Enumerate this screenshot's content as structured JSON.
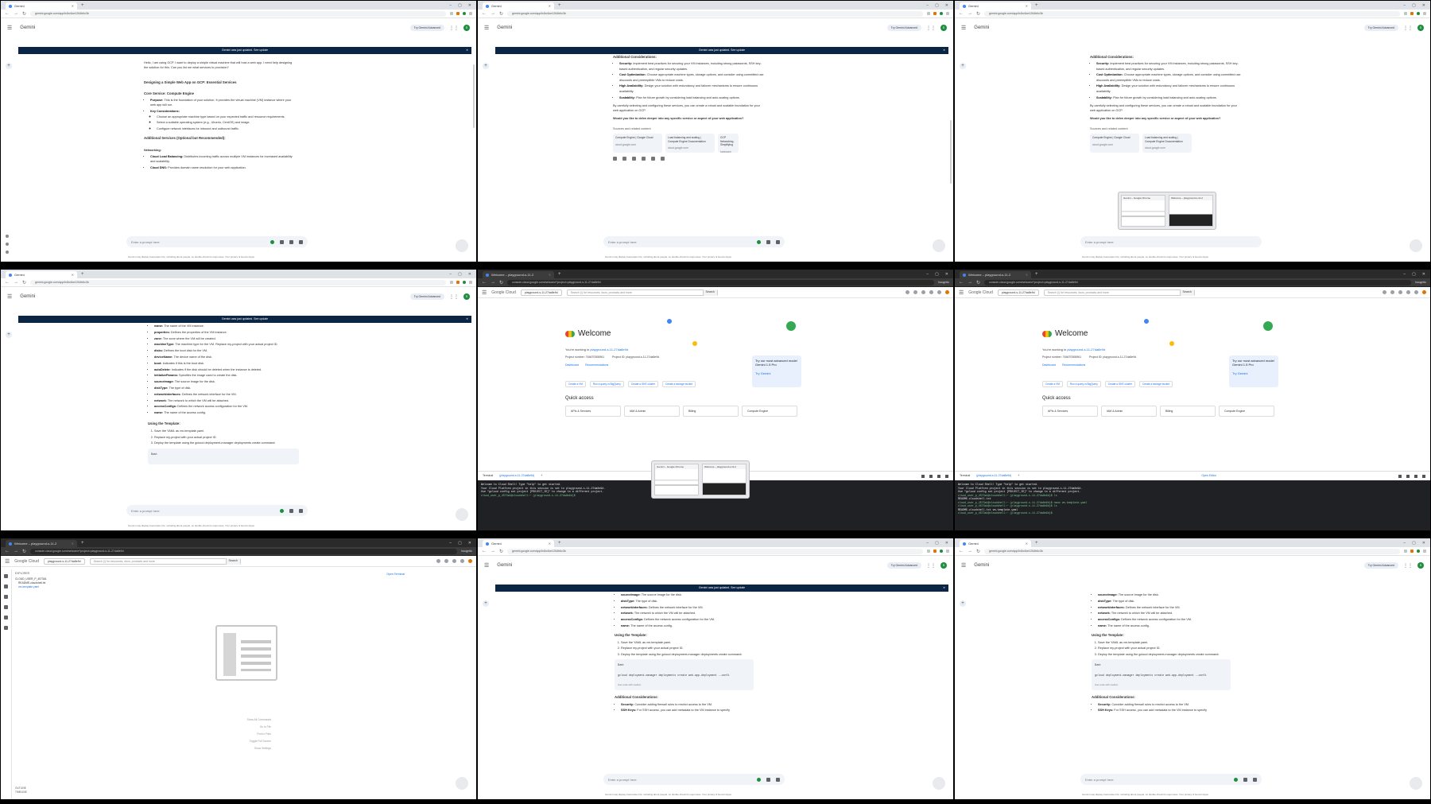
{
  "gemini": {
    "tab_label": "Gemini",
    "url": "gemini.google.com/app/b4bc6ce1264b6c3b",
    "app_title": "Gemini",
    "try_button": "Try Gemini Advanced",
    "avatar_letter": "S",
    "banner_text": "Gemini was just updated. See update",
    "prompt_placeholder": "Enter a prompt here",
    "footer": "Gemini may display inaccurate info, including about people, so double-check its responses. Your privacy & Gemini Apps"
  },
  "tile1": {
    "user_msg": "Hello, I am using GCP. I want to deploy a simple virtual machine that will host a web app. I need help designing the solution for this. Can you list me what services to provision?",
    "response_title": "Designing a Simple Web App on GCP: Essential Services",
    "core_heading": "Core Service: Compute Engine",
    "purpose_label": "Purpose:",
    "purpose_text": "This is the foundation of your solution. It provides the virtual machine (VM) instance where your web app will run.",
    "key_label": "Key Considerations:",
    "kc1": "Choose an appropriate machine type based on your expected traffic and resource requirements.",
    "kc2": "Select a suitable operating system (e.g., Ubuntu, CentOS) and image.",
    "kc3": "Configure network interfaces for inbound and outbound traffic.",
    "additional_heading": "Additional Services (Optional but Recommended):",
    "networking": "Networking:",
    "clb_label": "Cloud Load Balancing:",
    "clb_text": "Distributes incoming traffic across multiple VM instances for increased availability and scalability.",
    "dns_label": "Cloud DNS:",
    "dns_text": "Provides domain name resolution for your web application."
  },
  "tile2": {
    "heading": "Additional Considerations:",
    "sec_label": "Security:",
    "sec_text": "Implement best practices for securing your VM instances, including strong passwords, SSH key-based authentication, and regular security updates.",
    "cost_label": "Cost Optimization:",
    "cost_text": "Choose appropriate machine types, storage options, and consider using committed use discounts and preemptible VMs to reduce costs.",
    "ha_label": "High Availability:",
    "ha_text": "Design your solution with redundancy and failover mechanisms to ensure continuous availability.",
    "scale_label": "Scalability:",
    "scale_text": "Plan for future growth by considering load balancing and auto-scaling options.",
    "closing": "By carefully selecting and configuring these services, you can create a robust and scalable foundation for your web application on GCP.",
    "question": "Would you like to delve deeper into any specific service or aspect of your web application?",
    "sources_label": "Sources and related content",
    "src1_title": "Compute Engine | Google Cloud",
    "src1_url": "cloud.google.com",
    "src2_title": "Load balancing and scaling | Compute Engine Documentation",
    "src2_url": "cloud.google.com",
    "src3_title": "GCP Networking Simplifying",
    "src3_url": "hydrogen"
  },
  "tile4": {
    "items": [
      {
        "k": "name:",
        "v": "The name of the VM instance."
      },
      {
        "k": "properties:",
        "v": "Defines the properties of the VM instance."
      },
      {
        "k": "zone:",
        "v": "The zone where the VM will be created."
      },
      {
        "k": "machineType:",
        "v": "The machine type for the VM. Replace my-project with your actual project ID."
      },
      {
        "k": "disks:",
        "v": "Defines the boot disk for the VM."
      },
      {
        "k": "deviceName:",
        "v": "The device name of the disk."
      },
      {
        "k": "boot:",
        "v": "Indicates if this is the boot disk."
      },
      {
        "k": "autoDelete:",
        "v": "Indicates if the disk should be deleted when the instance is deleted."
      },
      {
        "k": "initializeParams:",
        "v": "Specifies the image used to create the disk."
      },
      {
        "k": "sourceImage:",
        "v": "The source image for the disk."
      },
      {
        "k": "diskType:",
        "v": "The type of disk."
      },
      {
        "k": "networkInterfaces:",
        "v": "Defines the network interface for the VM."
      },
      {
        "k": "network:",
        "v": "The network to which the VM will be attached."
      },
      {
        "k": "accessConfigs:",
        "v": "Defines the network access configuration for the VM."
      },
      {
        "k": "name:",
        "v": "The name of the access config."
      }
    ],
    "using": "Using the Template:",
    "step1": "Save the YAML as vm-template.yaml.",
    "step2": "Replace my-project with your actual project ID.",
    "step3": "Deploy the template using the gcloud deployment-manager deployments create command:",
    "bash": "Bash"
  },
  "tile8": {
    "items": [
      {
        "k": "sourceImage:",
        "v": "The source image for the disk."
      },
      {
        "k": "diskType:",
        "v": "The type of disk."
      },
      {
        "k": "networkInterfaces:",
        "v": "Defines the network interface for the VM."
      },
      {
        "k": "network:",
        "v": "The network to which the VM will be attached."
      },
      {
        "k": "accessConfigs:",
        "v": "Defines the network access configuration for the VM."
      },
      {
        "k": "name:",
        "v": "The name of the access config."
      }
    ],
    "command": "gcloud deployment-manager deployments create web-app-deployment --confi",
    "use_code": "Use code with caution.",
    "add_heading": "Additional Considerations:",
    "sec_label": "Security:",
    "sec_text": "Consider adding firewall rules to restrict access to the VM.",
    "ssh_label": "SSH Keys:",
    "ssh_text": "For SSH access, you can add metadata to the VM instance to specify"
  },
  "cloud": {
    "tab_label": "Welcome – playground-s-11-2",
    "url": "console.cloud.google.com/welcome?project=playground-s-11-27da8e9d",
    "incognito": "Incognito",
    "logo": "Google Cloud",
    "project": "playground-s-11-27da8e9d",
    "search_placeholder": "Search (/) for resources, docs, products and more",
    "search_button": "Search",
    "welcome": "Welcome",
    "working_in": "You're working in",
    "project_link": "playground-s-11-27da8e9d",
    "project_number": "Project number: 764670308961",
    "project_id": "Project ID: playground-s-11-27da8e9d",
    "dashboard": "Dashboard",
    "recommendations": "Recommendations",
    "actions": [
      "Create a VM",
      "Run a query in BigQuery",
      "Create a GKE cluster",
      "Create a storage bucket"
    ],
    "quick_access": "Quick access",
    "quick_cards": [
      "APIs & Services",
      "IAM & Admin",
      "Billing",
      "Compute Engine"
    ],
    "gemini_box": "Try our most advanced model Gemini 1.5 Pro",
    "try_gemini": "Try Gemini",
    "terminal_label": "Terminal",
    "terminal_tab": "(playground-s-11-27da8e9d)",
    "open_editor": "Open Editor",
    "term_lines5": [
      "Welcome to Cloud Shell! Type \"help\" to get started.",
      "Your Cloud Platform project in this session is set to playground-s-11-27da8e9d.",
      "Use \"gcloud config set project [PROJECT_ID]\" to change to a different project.",
      "cloud_user_p_4573a1@cloudshell:~ (playground-s-11-27da8e9d)$"
    ],
    "term_lines6": [
      "Welcome to Cloud Shell! Type \"help\" to get started.",
      "Your Cloud Platform project in this session is set to playground-s-11-27da8e9d.",
      "Use \"gcloud config set project [PROJECT_ID]\" to change to a different project.",
      "cloud_user_p_4573a1@cloudshell:~ (playground-s-11-27da8e9d)$ ls",
      "README-cloudshell.txt",
      "cloud_user_p_4573a1@cloudshell:~ (playground-s-11-27da8e9d)$ nano vm-template.yaml",
      "cloud_user_p_4573a1@cloudshell:~ (playground-s-11-27da8e9d)$ ls",
      "README-cloudshell.txt  vm-template.yaml",
      "cloud_user_p_4573a1@cloudshell:~ (playground-s-11-27da8e9d)$"
    ]
  },
  "switcher": {
    "item1": "Gemini – Google Chrome",
    "item2": "Welcome – playground-s-11-2"
  },
  "editor": {
    "explorer_label": "EXPLORER",
    "folder": "CLOUD_USER_P_4573A1",
    "file1": "README-cloudshell.txt",
    "file2": "vm-template.yaml",
    "open_editor": "Open Terminal",
    "shortcuts": [
      "Show All Commands",
      "Go to File",
      "Find in Files",
      "Toggle Full Screen",
      "Show Settings"
    ],
    "outline": "OUTLINE",
    "timeline": "TIMELINE"
  }
}
